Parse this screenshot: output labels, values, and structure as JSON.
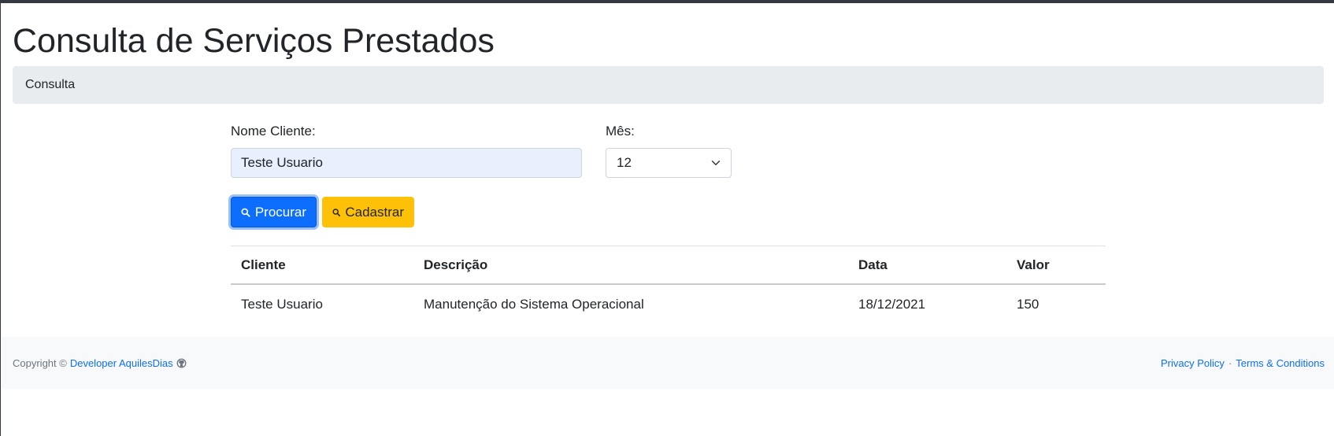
{
  "page": {
    "title": "Consulta de Serviços Prestados",
    "breadcrumb": "Consulta"
  },
  "form": {
    "client_label": "Nome Cliente:",
    "client_value": "Teste Usuario",
    "month_label": "Mês:",
    "month_value": "12",
    "search_button": "Procurar",
    "register_button": "Cadastrar"
  },
  "table": {
    "headers": [
      "Cliente",
      "Descrição",
      "Data",
      "Valor"
    ],
    "rows": [
      [
        "Teste Usuario",
        "Manutenção do Sistema Operacional",
        "18/12/2021",
        "150"
      ]
    ]
  },
  "footer": {
    "copyright_text": "Copyright ©",
    "developer_link": "Developer AquilesDias",
    "privacy_link": "Privacy Policy",
    "separator": "·",
    "terms_link": "Terms & Conditions"
  },
  "icons": {
    "search": "search-icon",
    "github": "github-icon",
    "chevron": "chevron-down-icon"
  },
  "colors": {
    "primary": "#0d6efd",
    "warning": "#ffc107",
    "breadcrumb_bg": "#e9ecef",
    "footer_bg": "#f8f9fa"
  }
}
